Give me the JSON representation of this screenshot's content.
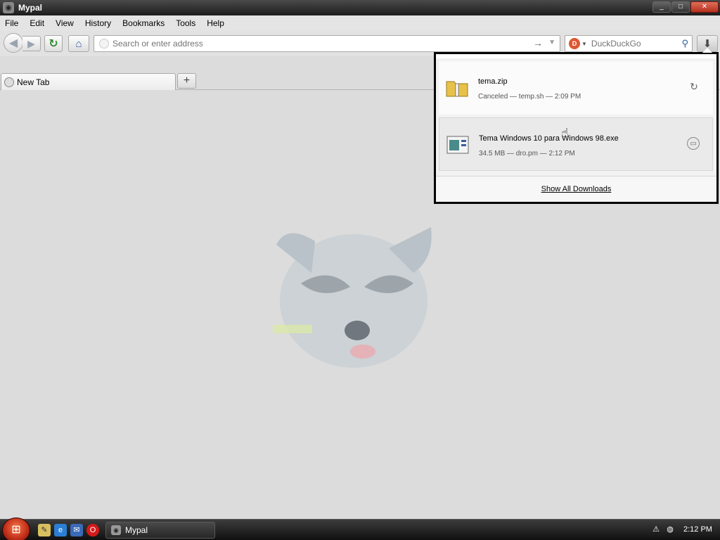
{
  "window": {
    "title": "Mypal",
    "minimize": "_",
    "maximize": "□",
    "close": "✕"
  },
  "menu": [
    "File",
    "Edit",
    "View",
    "History",
    "Bookmarks",
    "Tools",
    "Help"
  ],
  "nav": {
    "back_icon": "arrow-left-icon",
    "forward_icon": "arrow-right-icon",
    "reload_icon": "reload-icon",
    "home_icon": "home-icon",
    "url_placeholder": "Search or enter address",
    "url_value": "",
    "search_engine": "DuckDuckGo",
    "search_placeholder": "DuckDuckGo",
    "downloads_icon": "download-arrow-icon"
  },
  "tabs": [
    {
      "label": "New Tab",
      "active": true
    }
  ],
  "new_tab_label": "+",
  "downloads": {
    "items": [
      {
        "name": "tema.zip",
        "meta": "Canceled — temp.sh — 2:09 PM",
        "icon": "zip-file-icon",
        "action_icon": "retry-icon"
      },
      {
        "name": "Tema Windows 10 para Windows 98.exe",
        "meta": "34.5 MB — dro.pm — 2:12 PM",
        "icon": "exe-file-icon",
        "action_icon": "open-folder-icon"
      }
    ],
    "show_all_label": "Show All Downloads"
  },
  "taskbar": {
    "start_icon": "windows-start-icon",
    "quick_launch": [
      "notepad-icon",
      "internet-explorer-icon",
      "outlook-icon",
      "opera-icon"
    ],
    "task_label": "Mypal",
    "clock": "2:12 PM"
  },
  "colors": {
    "title_bar": "#2a2a2a",
    "content_bg": "#dcdcdc",
    "accent_blue": "#2b5ca0",
    "start_red": "#c4301a"
  }
}
